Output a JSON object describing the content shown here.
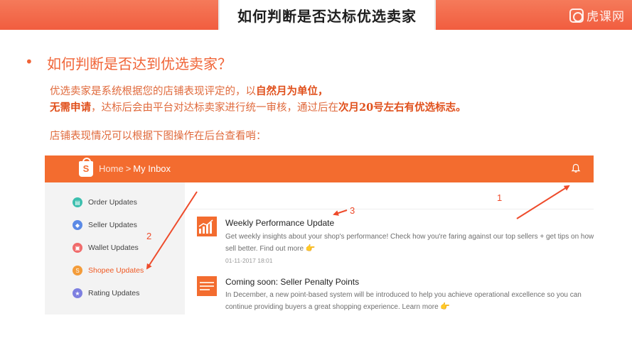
{
  "slide": {
    "title": "如何判断是否达标优选卖家",
    "watermark": "虎课网",
    "bullet": "•",
    "heading": "如何判断是否达到优选卖家？",
    "p1_normal": "优选卖家是系统根据您的店铺表现评定的，以",
    "p1_bold": "自然月为单位，",
    "p2_bold1": "无需申请",
    "p2_normal": "，达标后会由平台对达标卖家进行统一审核，通过后在",
    "p2_bold2": "次月20号左右有优选标志。",
    "p3": "店铺表现情况可以根据下图操作在后台查看哨：",
    "accent_color": "#f06437"
  },
  "screenshot": {
    "logo_letter": "S",
    "breadcrumb_home": "Home",
    "breadcrumb_sep": ">",
    "breadcrumb_current": "My Inbox",
    "header_color": "#f36c2f",
    "sidebar": {
      "items": [
        {
          "label": "Order Updates",
          "icon": "order-icon",
          "color": "#3cbfae"
        },
        {
          "label": "Seller Updates",
          "icon": "seller-icon",
          "color": "#5b8ae6"
        },
        {
          "label": "Wallet Updates",
          "icon": "wallet-icon",
          "color": "#f06b6b"
        },
        {
          "label": "Shopee Updates",
          "icon": "shopee-icon",
          "color": "#f39c3a",
          "active": true
        },
        {
          "label": "Rating Updates",
          "icon": "rating-icon",
          "color": "#7d7fe0"
        }
      ]
    },
    "messages": [
      {
        "title": "Weekly Performance Update",
        "desc_line1": "Get weekly insights about your shop's performance! Check how you're faring against our top sellers + get tips on how",
        "desc_line2": "sell better. Find out more",
        "date": "01-11-2017 18:01",
        "icon": "chart-icon"
      },
      {
        "title": "Coming soon: Seller Penalty Points",
        "desc_line1": "In December, a new point-based system will be introduced to help you achieve operational excellence so you can",
        "desc_line2": "continue providing buyers a great shopping experience. Learn more",
        "icon": "penalty-icon"
      }
    ],
    "hand_glyph": "👉"
  },
  "annotations": {
    "n1": "1",
    "n2": "2",
    "n3": "3",
    "color": "#ee4b2b"
  }
}
